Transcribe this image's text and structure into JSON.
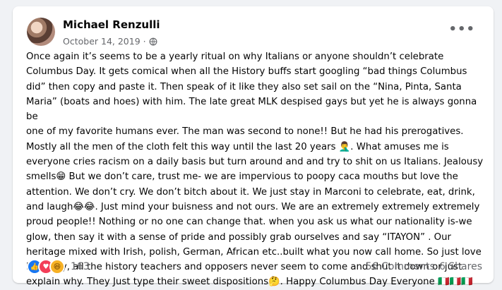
{
  "post": {
    "author": "Michael Renzulli",
    "date": "October 14, 2019",
    "separator": "·",
    "privacy_icon": "globe-icon",
    "more_icon": "ellipsis-icon",
    "text": "Once again it’s seems to be a yearly ritual on why Italians or anyone shouldn’t celebrate\nColumbus Day. It gets comical when all the History buffs start googling “bad things Columbus\ndid” then copy and paste it. Then speak of it like they also set sail on the “Nina, Pinta, Santa\nMaria” (boats and hoes) with him. The late great MLK despised gays but yet he is always gonna be\none of my favorite humans ever. The man was second to none!! But he had his prerogatives.\nMostly all the men of the cloth felt this way until the last 20 years 🤦‍♂️. What amuses me is\neveryone cries racism on a daily basis but turn around and and try to shit on us Italians. Jealousy\nsmells😁 But we don’t care, trust me- we are impervious to poopy caca mouths but love the\nattention. We don’t cry. We don’t bitch about it. We just stay in Marconi to celebrate, eat, drink,\nand laugh😂😂. Just mind your buisness and not ours. We are an extremely extremely extremely\nproud people!! Nothing or no one can change that. when you ask us what our nationality is-we\nglow, then say it with a sense of pride and possibly grab ourselves and say “ITAYON” . Our\nheritage mixed with Irish, polish, German, African etc..built what you now call home. So just love\nit! Lastly, all the history teachers and opposers never seem to come and shut it down or just\nexplain why. They Just type their sweet dispositions🤔. Happy Columbus Day Everyone 🇮🇹🇮🇹🇮🇹"
  },
  "footer": {
    "reaction_icons": [
      "like-icon",
      "love-icon",
      "haha-icon"
    ],
    "reaction_count": "163",
    "comments": "56 Comments",
    "shares": "6 Shares"
  },
  "colors": {
    "background": "#f0f2f5",
    "card": "#ffffff",
    "secondary_text": "#65676b",
    "like_blue": "#1877f2",
    "love_red": "#f33e58",
    "haha_yellow": "#f7b125"
  }
}
